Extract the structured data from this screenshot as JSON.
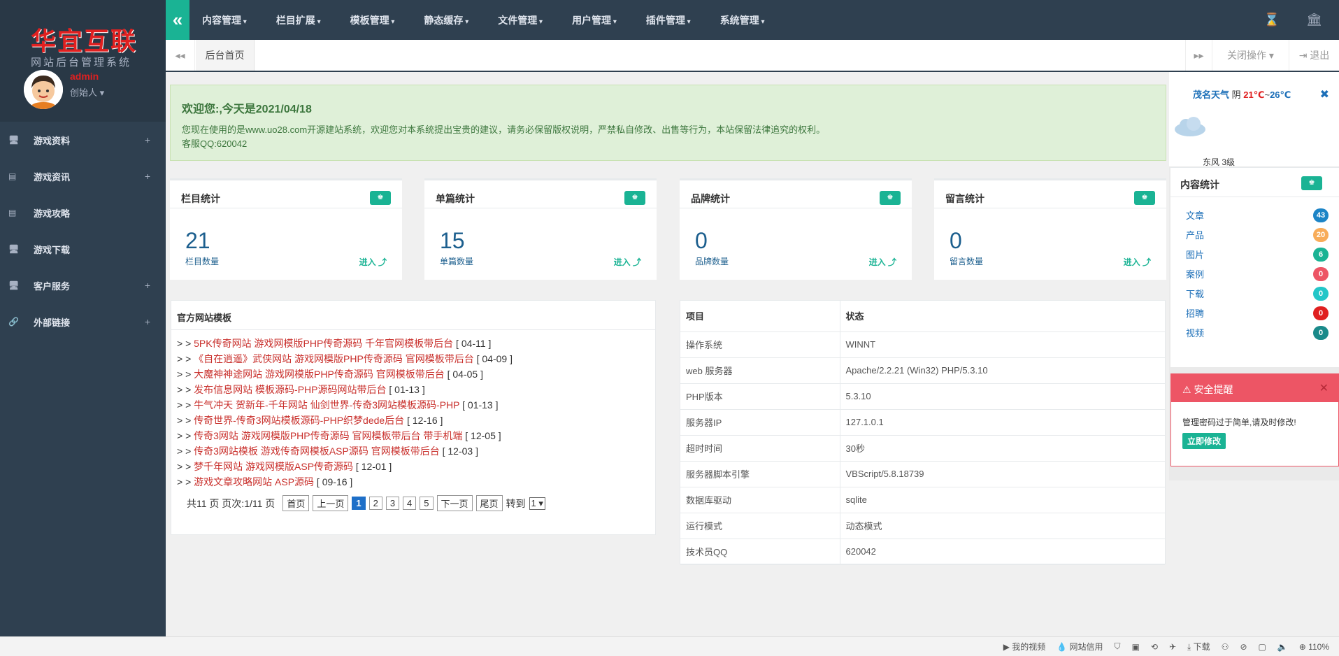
{
  "brand": {
    "logo": "华宜互联",
    "subtitle": "网站后台管理系统",
    "user_name": "admin",
    "user_role": "创始人 ▾"
  },
  "sidebar": {
    "items": [
      {
        "label": "游戏资料",
        "icon": "monitor-icon",
        "expandable": "+"
      },
      {
        "label": "游戏资讯",
        "icon": "card-icon",
        "expandable": "+"
      },
      {
        "label": "游戏攻略",
        "icon": "card-icon",
        "expandable": ""
      },
      {
        "label": "游戏下载",
        "icon": "monitor-icon",
        "expandable": ""
      },
      {
        "label": "客户服务",
        "icon": "monitor-icon",
        "expandable": "+"
      },
      {
        "label": "外部链接",
        "icon": "link-icon",
        "expandable": "+"
      }
    ]
  },
  "topmenu": {
    "items": [
      "内容管理",
      "栏目扩展",
      "模板管理",
      "静态缓存",
      "文件管理",
      "用户管理",
      "插件管理",
      "系统管理"
    ],
    "collapse_icon": "double-chevron-left-icon",
    "right_icons": [
      "hourglass-icon",
      "bank-icon"
    ]
  },
  "tabs": {
    "prev": "◂◂",
    "home": "后台首页",
    "next": "▸▸",
    "close_ops": "关闭操作 ▾",
    "logout": "⇥ 退出"
  },
  "welcome": {
    "title": "欢迎您:,今天是2021/04/18",
    "line1": "您现在使用的是www.uo28.com开源建站系统，欢迎您对本系统提出宝贵的建议，请务必保留版权说明，严禁私自修改、出售等行为，本站保留法律追究的权利。",
    "line2": "客服QQ:620042"
  },
  "stats": [
    {
      "title": "栏目统计",
      "value": "21",
      "label": "栏目数量",
      "enter": "进入 ⤴"
    },
    {
      "title": "单篇统计",
      "value": "15",
      "label": "单篇数量",
      "enter": "进入 ⤴"
    },
    {
      "title": "品牌统计",
      "value": "0",
      "label": "品牌数量",
      "enter": "进入 ⤴"
    },
    {
      "title": "留言统计",
      "value": "0",
      "label": "留言数量",
      "enter": "进入 ⤴"
    }
  ],
  "templates": {
    "title": "官方网站模板",
    "items": [
      {
        "prefix": "> > ",
        "link": "5PK传奇网站 游戏网模版PHP传奇源码 千年官网模板带后台",
        "date": "  [ 04-11 ]"
      },
      {
        "prefix": "> > ",
        "link": "《自在逍遥》武侠网站 游戏网模版PHP传奇源码 官网模板带后台",
        "date": "  [ 04-09 ]"
      },
      {
        "prefix": "> > ",
        "link": "大魔神神途网站 游戏网模版PHP传奇源码 官网模板带后台",
        "date": "  [ 04-05 ]"
      },
      {
        "prefix": "> > ",
        "link": "发布信息网站 模板源码-PHP源码网站带后台",
        "date": "  [ 01-13 ]"
      },
      {
        "prefix": "> > ",
        "link": "牛气冲天 贺新年-千年网站 仙剑世界-传奇3网站模板源码-PHP",
        "date": "  [ 01-13 ]"
      },
      {
        "prefix": "> > ",
        "link": "传奇世界-传奇3网站模板源码-PHP织梦dede后台",
        "date": "  [ 12-16 ]"
      },
      {
        "prefix": "> > ",
        "link": "传奇3网站 游戏网模版PHP传奇源码 官网模板带后台 带手机端",
        "date": "  [ 12-05 ]"
      },
      {
        "prefix": "> > ",
        "link": "传奇3网站模板 游戏传奇网模板ASP源码 官网模板带后台",
        "date": "  [ 12-03 ]"
      },
      {
        "prefix": "> > ",
        "link": "梦千年网站 游戏网模版ASP传奇源码",
        "date": "  [ 12-01 ]"
      },
      {
        "prefix": "> > ",
        "link": "游戏文章攻略网站 ASP源码",
        "date": "  [ 09-16 ]"
      }
    ],
    "pager": {
      "summary": "共11 页 页次:1/11 页",
      "first": "首页",
      "prev": "上一页",
      "pages": [
        "1",
        "2",
        "3",
        "4",
        "5"
      ],
      "current": "1",
      "next": "下一页",
      "last": "尾页",
      "goto": "转到",
      "select_value": "1 ▾"
    }
  },
  "system": {
    "header": [
      "项目",
      "状态"
    ],
    "rows": [
      [
        "操作系统",
        "WINNT"
      ],
      [
        "web 服务器",
        "Apache/2.2.21 (Win32) PHP/5.3.10"
      ],
      [
        "PHP版本",
        "5.3.10"
      ],
      [
        "服务器IP",
        "127.1.0.1"
      ],
      [
        "超时时间",
        "30秒"
      ],
      [
        "服务器脚本引擎",
        "VBScript/5.8.18739"
      ],
      [
        "数据库驱动",
        "sqlite"
      ],
      [
        "运行模式",
        "动态模式"
      ],
      [
        "技术员QQ",
        "620042"
      ]
    ]
  },
  "weather": {
    "city": "茂名天气",
    "condition": "阴",
    "low": "21℃",
    "sep": "~",
    "high": "26℃",
    "wind": "东风 3级",
    "close": "✖"
  },
  "content_stats": {
    "title": "内容统计",
    "items": [
      {
        "label": "文章",
        "count": "43",
        "color": "#1c84c6"
      },
      {
        "label": "产品",
        "count": "20",
        "color": "#f8ac59"
      },
      {
        "label": "图片",
        "count": "6",
        "color": "#1ab394"
      },
      {
        "label": "案例",
        "count": "0",
        "color": "#ed5565"
      },
      {
        "label": "下载",
        "count": "0",
        "color": "#23c6c8"
      },
      {
        "label": "招聘",
        "count": "0",
        "color": "#e02020"
      },
      {
        "label": "视频",
        "count": "0",
        "color": "#1a8a8a"
      }
    ]
  },
  "alert": {
    "title": "⚠ 安全提醒",
    "close": "✕",
    "message": "管理密码过于简单,请及时修改!",
    "button": "立即修改"
  },
  "statusbar": {
    "items": [
      "▶ 我的视频",
      "💧 网站信用",
      "⛉",
      "▣",
      "⟲",
      "✈",
      "⤓ 下载",
      "⚇",
      "⊘",
      "▢",
      "🔈",
      "⊕ 110%"
    ]
  },
  "colors": {
    "sidebar": "#2f4050",
    "accent": "#1ab394",
    "link": "#c9302c"
  }
}
